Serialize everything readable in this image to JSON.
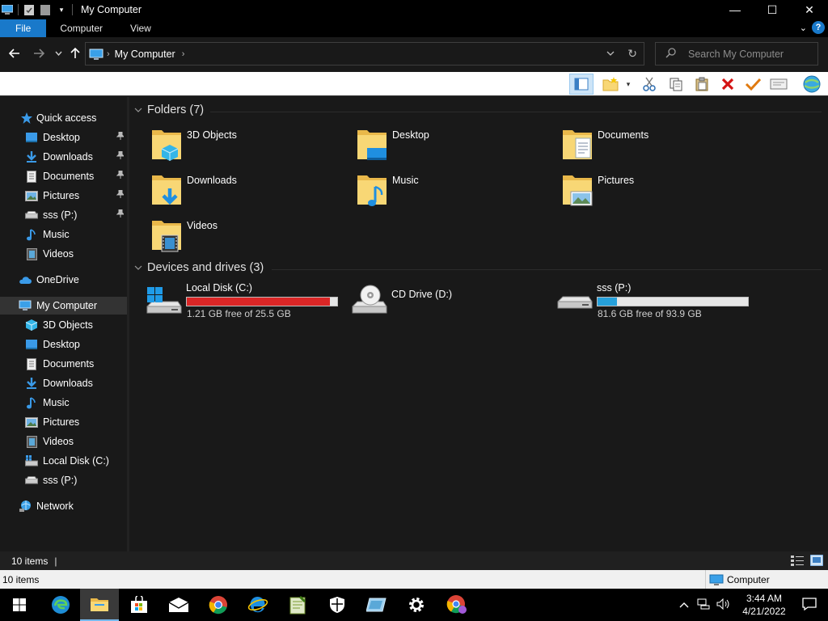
{
  "window": {
    "title": "My Computer",
    "controls": {
      "minimize": "—",
      "maximize": "☐",
      "close": "✕"
    }
  },
  "ribbon": {
    "tabs": [
      "File",
      "Computer",
      "View"
    ],
    "help": "?"
  },
  "address": {
    "crumb": "My Computer",
    "search_placeholder": "Search My Computer"
  },
  "sidebar": {
    "quick_access": "Quick access",
    "quick_items": [
      {
        "label": "Desktop",
        "icon": "desktop-icon",
        "pinned": true
      },
      {
        "label": "Downloads",
        "icon": "downloads-icon",
        "pinned": true
      },
      {
        "label": "Documents",
        "icon": "documents-icon",
        "pinned": true
      },
      {
        "label": "Pictures",
        "icon": "pictures-icon",
        "pinned": true
      },
      {
        "label": "sss (P:)",
        "icon": "drive-icon",
        "pinned": true
      },
      {
        "label": "Music",
        "icon": "music-icon",
        "pinned": false
      },
      {
        "label": "Videos",
        "icon": "videos-icon",
        "pinned": false
      }
    ],
    "onedrive": "OneDrive",
    "my_computer": "My Computer",
    "computer_items": [
      {
        "label": "3D Objects",
        "icon": "3d-objects-icon"
      },
      {
        "label": "Desktop",
        "icon": "desktop-icon"
      },
      {
        "label": "Documents",
        "icon": "documents-icon"
      },
      {
        "label": "Downloads",
        "icon": "downloads-icon"
      },
      {
        "label": "Music",
        "icon": "music-icon"
      },
      {
        "label": "Pictures",
        "icon": "pictures-icon"
      },
      {
        "label": "Videos",
        "icon": "videos-icon"
      },
      {
        "label": "Local Disk (C:)",
        "icon": "windows-drive-icon"
      },
      {
        "label": "sss (P:)",
        "icon": "drive-icon"
      }
    ],
    "network": "Network"
  },
  "content": {
    "folders_header": "Folders (7)",
    "folders": [
      {
        "label": "3D Objects",
        "icon": "3d-objects-folder-icon"
      },
      {
        "label": "Desktop",
        "icon": "desktop-folder-icon"
      },
      {
        "label": "Documents",
        "icon": "documents-folder-icon"
      },
      {
        "label": "Downloads",
        "icon": "downloads-folder-icon"
      },
      {
        "label": "Music",
        "icon": "music-folder-icon"
      },
      {
        "label": "Pictures",
        "icon": "pictures-folder-icon"
      },
      {
        "label": "Videos",
        "icon": "videos-folder-icon"
      }
    ],
    "drives_header": "Devices and drives (3)",
    "drives": [
      {
        "label": "Local Disk (C:)",
        "free": "1.21 GB free of 25.5 GB",
        "used_fraction": 0.953,
        "bar_color": "#da2626",
        "icon": "windows-drive-icon"
      },
      {
        "label": "CD Drive (D:)",
        "free": "",
        "used_fraction": null,
        "bar_color": "",
        "icon": "cd-drive-icon"
      },
      {
        "label": "sss (P:)",
        "free": "81.6 GB free of 93.9 GB",
        "used_fraction": 0.131,
        "bar_color": "#26a0da",
        "icon": "drive-icon"
      }
    ]
  },
  "status": {
    "count": "10 items",
    "count2": "10 items",
    "zone": "Computer"
  },
  "taskbar": {
    "time": "3:44 AM",
    "date": "4/21/2022"
  },
  "colors": {
    "accent": "#1979ca",
    "folder": "#f8d775",
    "background": "#191919"
  }
}
